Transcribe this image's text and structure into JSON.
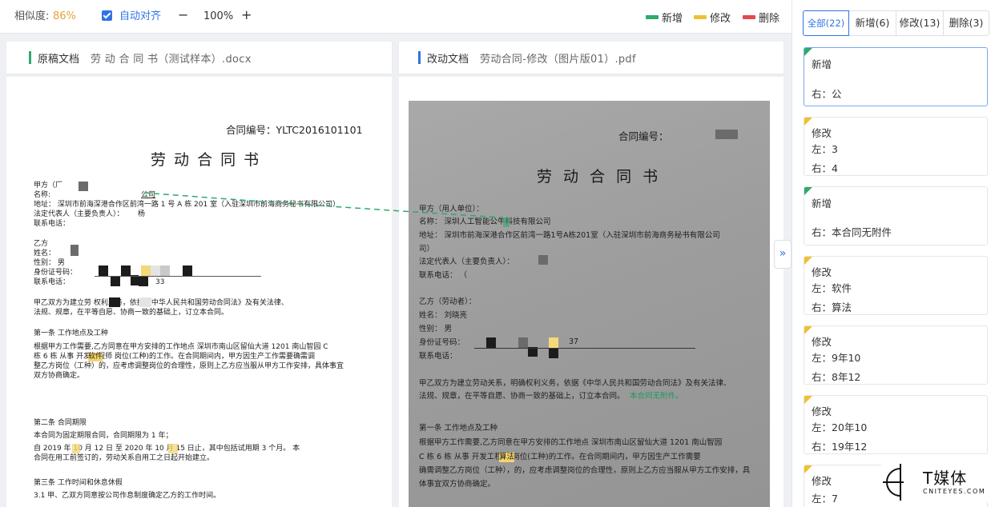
{
  "toolbar": {
    "similarity_label": "相似度:",
    "similarity_value": "86%",
    "auto_align_label": "自动对齐",
    "auto_align_checked": true,
    "zoom_minus": "−",
    "zoom_value": "100%",
    "zoom_plus": "+",
    "legend": [
      {
        "label": "新增",
        "color": "#2eaa6b"
      },
      {
        "label": "修改",
        "color": "#f0c030"
      },
      {
        "label": "删除",
        "color": "#e5484d"
      }
    ]
  },
  "left_pane": {
    "kind": "原稿文档",
    "filename": "劳 动 合 同 书（测试样本）.docx",
    "doc": {
      "contract_no": "合同编号：YLTC2016101101",
      "title": "劳 动 合 同 书",
      "party_a_heading": "甲方（厂",
      "party_a_lines": [
        "名称:",
        "地址：   深圳市前海深港合作区前湾一路 1 号 A 栋 201 室（入驻深圳市前海商务秘书有限公司）",
        "法定代表人（主要负责人）：   ",
        "联系电话："
      ],
      "party_a_name_tail": "公司",
      "party_a_rep_tail": "杨",
      "party_b_heading": "乙方",
      "party_b_lines": [
        "姓名：",
        "性别：    男",
        "身份证号码：",
        "联系电话："
      ],
      "party_b_phone_tail": "33",
      "intro": [
        "      甲乙双方为建立劳                            权利义务，依据《中华人民共和国劳动合同法》及有关法律、",
        "法规、规章，在平等自愿、协商一致的基础上，订立本合同。"
      ],
      "art1_title": "第一条  工作地点及工种",
      "art1": [
        "      根据甲方工作需要,乙方同意在甲方安排的工作地点   深圳市南山区留仙大道 1201 南山智园 C",
        "栋 6 栋     从事      开发工程师   岗位(工种)的工作。在合同期间内，甲方因生产工作需要确需调",
        "整乙方岗位（工种）的，应考虑调整岗位的合理性，原则上乙方应当服从甲方工作安排，具体事宜",
        "双方协商确定。"
      ],
      "art1_hl": "软件",
      "art2_title": "第二条  合同期限",
      "art2": [
        "      本合同为固定期限合同，合同期限为      1      年；",
        "      自    2019    年   10   月  12  日  至    2020   年   10   月   15   日止，其中包括试用期     3     个月。 本",
        "合同在用工前签订的，劳动关系自用工之日起开始建立。"
      ],
      "art3_title": "第三条  工作时间和休息休假",
      "art3": [
        "      3.1  甲、乙双方同意按公司作息制度确定乙方的工作时间。"
      ]
    }
  },
  "right_pane": {
    "kind": "改动文档",
    "filename": "劳动合同-修改（图片版01）.pdf",
    "doc": {
      "contract_no": "合同编号：",
      "title": "劳 动 合 同 书",
      "party_a": [
        "甲方（用人单位）：",
        "名称：     深圳人工智能公牛科技有限公司",
        "地址：     深圳市前海深港合作区前湾一路1号A栋201室（入驻深圳市前海商务秘书有限公司",
        "司）",
        "法定代表人（主要负责人）：",
        "联系电话：    （"
      ],
      "party_b": [
        "乙方（劳动者）：",
        "姓名：       刘晓亮",
        "性别：    男",
        "身份证号码：",
        "联系电话："
      ],
      "id_tail": "37",
      "intro": [
        "      甲乙双方为建立劳动关系，明确权利义务，依据《中华人民共和国劳动合同法》及有关法律、",
        "法规、规章，在平等自愿、协商一致的基础上，订立本合同。"
      ],
      "intro_added": "本合同无附件。",
      "art1_title": "第一条  工作地点及工种",
      "art1": [
        "      根据甲方工作需要,乙方同意在甲方安排的工作地点     深圳市南山区留仙大道 1201 南山智园",
        "C 栋 6 栋       从事      开发工程师      岗位(工种)的工作。在合同期间内，甲方因生产工作需要",
        "确需调整乙方岗位（工种），的，应考虑调整岗位的合理性，原则上乙方应当服从甲方工作安排，具",
        "体事宜双方协商确定。"
      ],
      "art1_hl": "算法"
    }
  },
  "diff_panel": {
    "tabs": [
      {
        "label": "全部(22)",
        "active": true
      },
      {
        "label": "新增(6)",
        "active": false
      },
      {
        "label": "修改(13)",
        "active": false
      },
      {
        "label": "删除(3)",
        "active": false
      }
    ],
    "cards": [
      {
        "type": "新增",
        "kind": "add",
        "lines": [
          "右：公"
        ],
        "active": true
      },
      {
        "type": "修改",
        "kind": "mod",
        "lines": [
          "左：3",
          "右：4"
        ]
      },
      {
        "type": "新增",
        "kind": "add",
        "lines": [
          "右：本合同无附件"
        ]
      },
      {
        "type": "修改",
        "kind": "mod",
        "lines": [
          "左：软件",
          "右：算法"
        ]
      },
      {
        "type": "修改",
        "kind": "mod",
        "lines": [
          "左：9年10",
          "右：8年12"
        ]
      },
      {
        "type": "修改",
        "kind": "mod",
        "lines": [
          "左：20年10",
          "右：19年12"
        ]
      },
      {
        "type": "修改",
        "kind": "mod",
        "lines": [
          "左：7"
        ]
      }
    ],
    "collapse_label": "»"
  },
  "watermark": {
    "title": "T媒体",
    "subtitle": "CNITEYES.COM"
  }
}
